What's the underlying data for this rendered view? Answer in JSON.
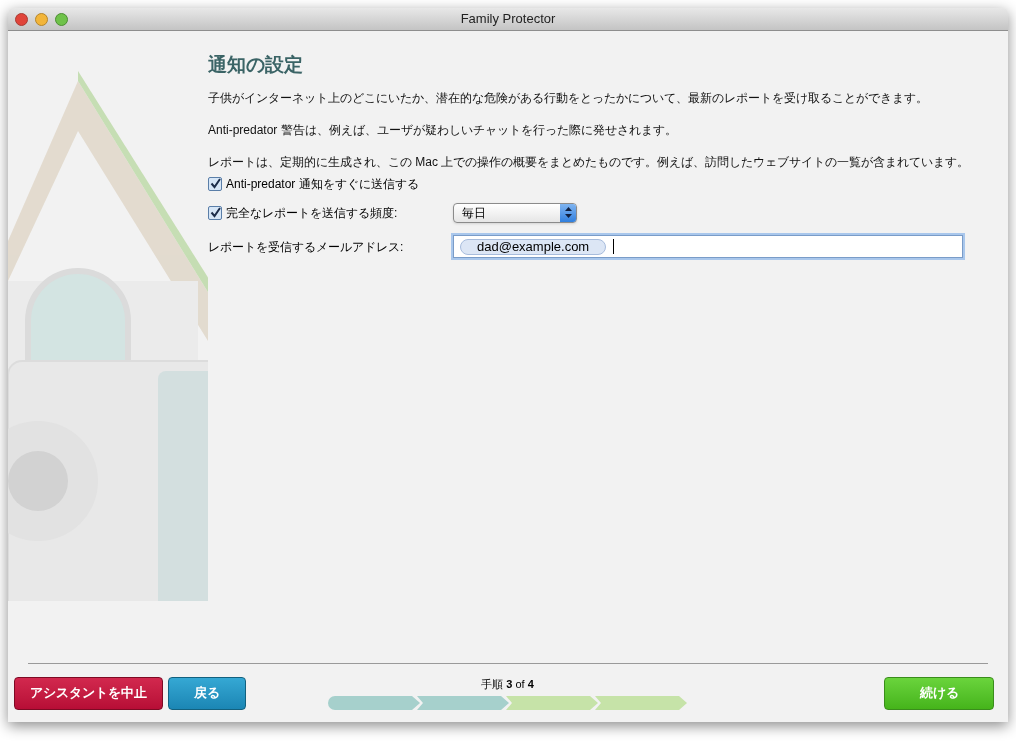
{
  "window": {
    "title": "Family Protector"
  },
  "heading": "通知の設定",
  "paragraphs": [
    "子供がインターネット上のどこにいたか、潜在的な危険がある行動をとったかについて、最新のレポートを受け取ることができます。",
    "Anti-predator 警告は、例えば、ユーザが疑わしいチャットを行った際に発せされます。",
    "レポートは、定期的に生成され、この Mac 上での操作の概要をまとめたものです。例えば、訪問したウェブサイトの一覧が含まれています。"
  ],
  "options": [
    {
      "kind": "checkbox",
      "label": "Anti-predator 通知をすぐに送信する",
      "checked": true
    },
    {
      "kind": "checkbox-select",
      "label": "完全なレポートを送信する頻度:",
      "checked": true,
      "value": "毎日"
    },
    {
      "kind": "email",
      "label": "レポートを受信するメールアドレス:",
      "tokens": [
        "dad@example.com"
      ]
    }
  ],
  "footer": {
    "cancel": "アシスタントを中止",
    "back": "戻る",
    "step_text": "手順 **3** of **4**",
    "continue": "続ける",
    "steps": [
      {
        "done": true
      },
      {
        "done": true
      },
      {
        "done": false
      },
      {
        "done": false
      }
    ]
  }
}
